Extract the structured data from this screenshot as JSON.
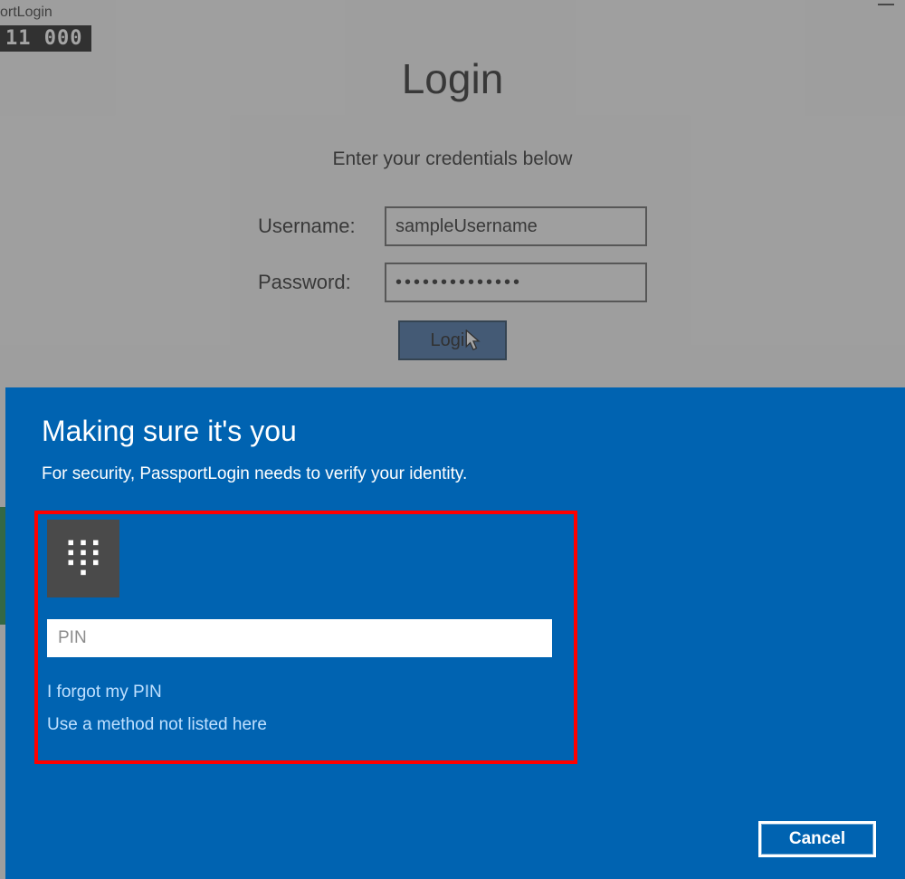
{
  "window": {
    "title_fragment": "ortLogin",
    "black_strip": "11   000"
  },
  "login": {
    "title": "Login",
    "subtitle": "Enter your credentials below",
    "username_label": "Username:",
    "username_value": "sampleUsername",
    "password_label": "Password:",
    "password_value": "••••••••••••••",
    "button_label": "Login"
  },
  "dialog": {
    "title": "Making sure it's you",
    "subtitle": "For security, PassportLogin needs to verify your identity.",
    "pin_placeholder": "PIN",
    "forgot_link": "I forgot my PIN",
    "other_method_link": "Use a method not listed here",
    "cancel_label": "Cancel"
  }
}
